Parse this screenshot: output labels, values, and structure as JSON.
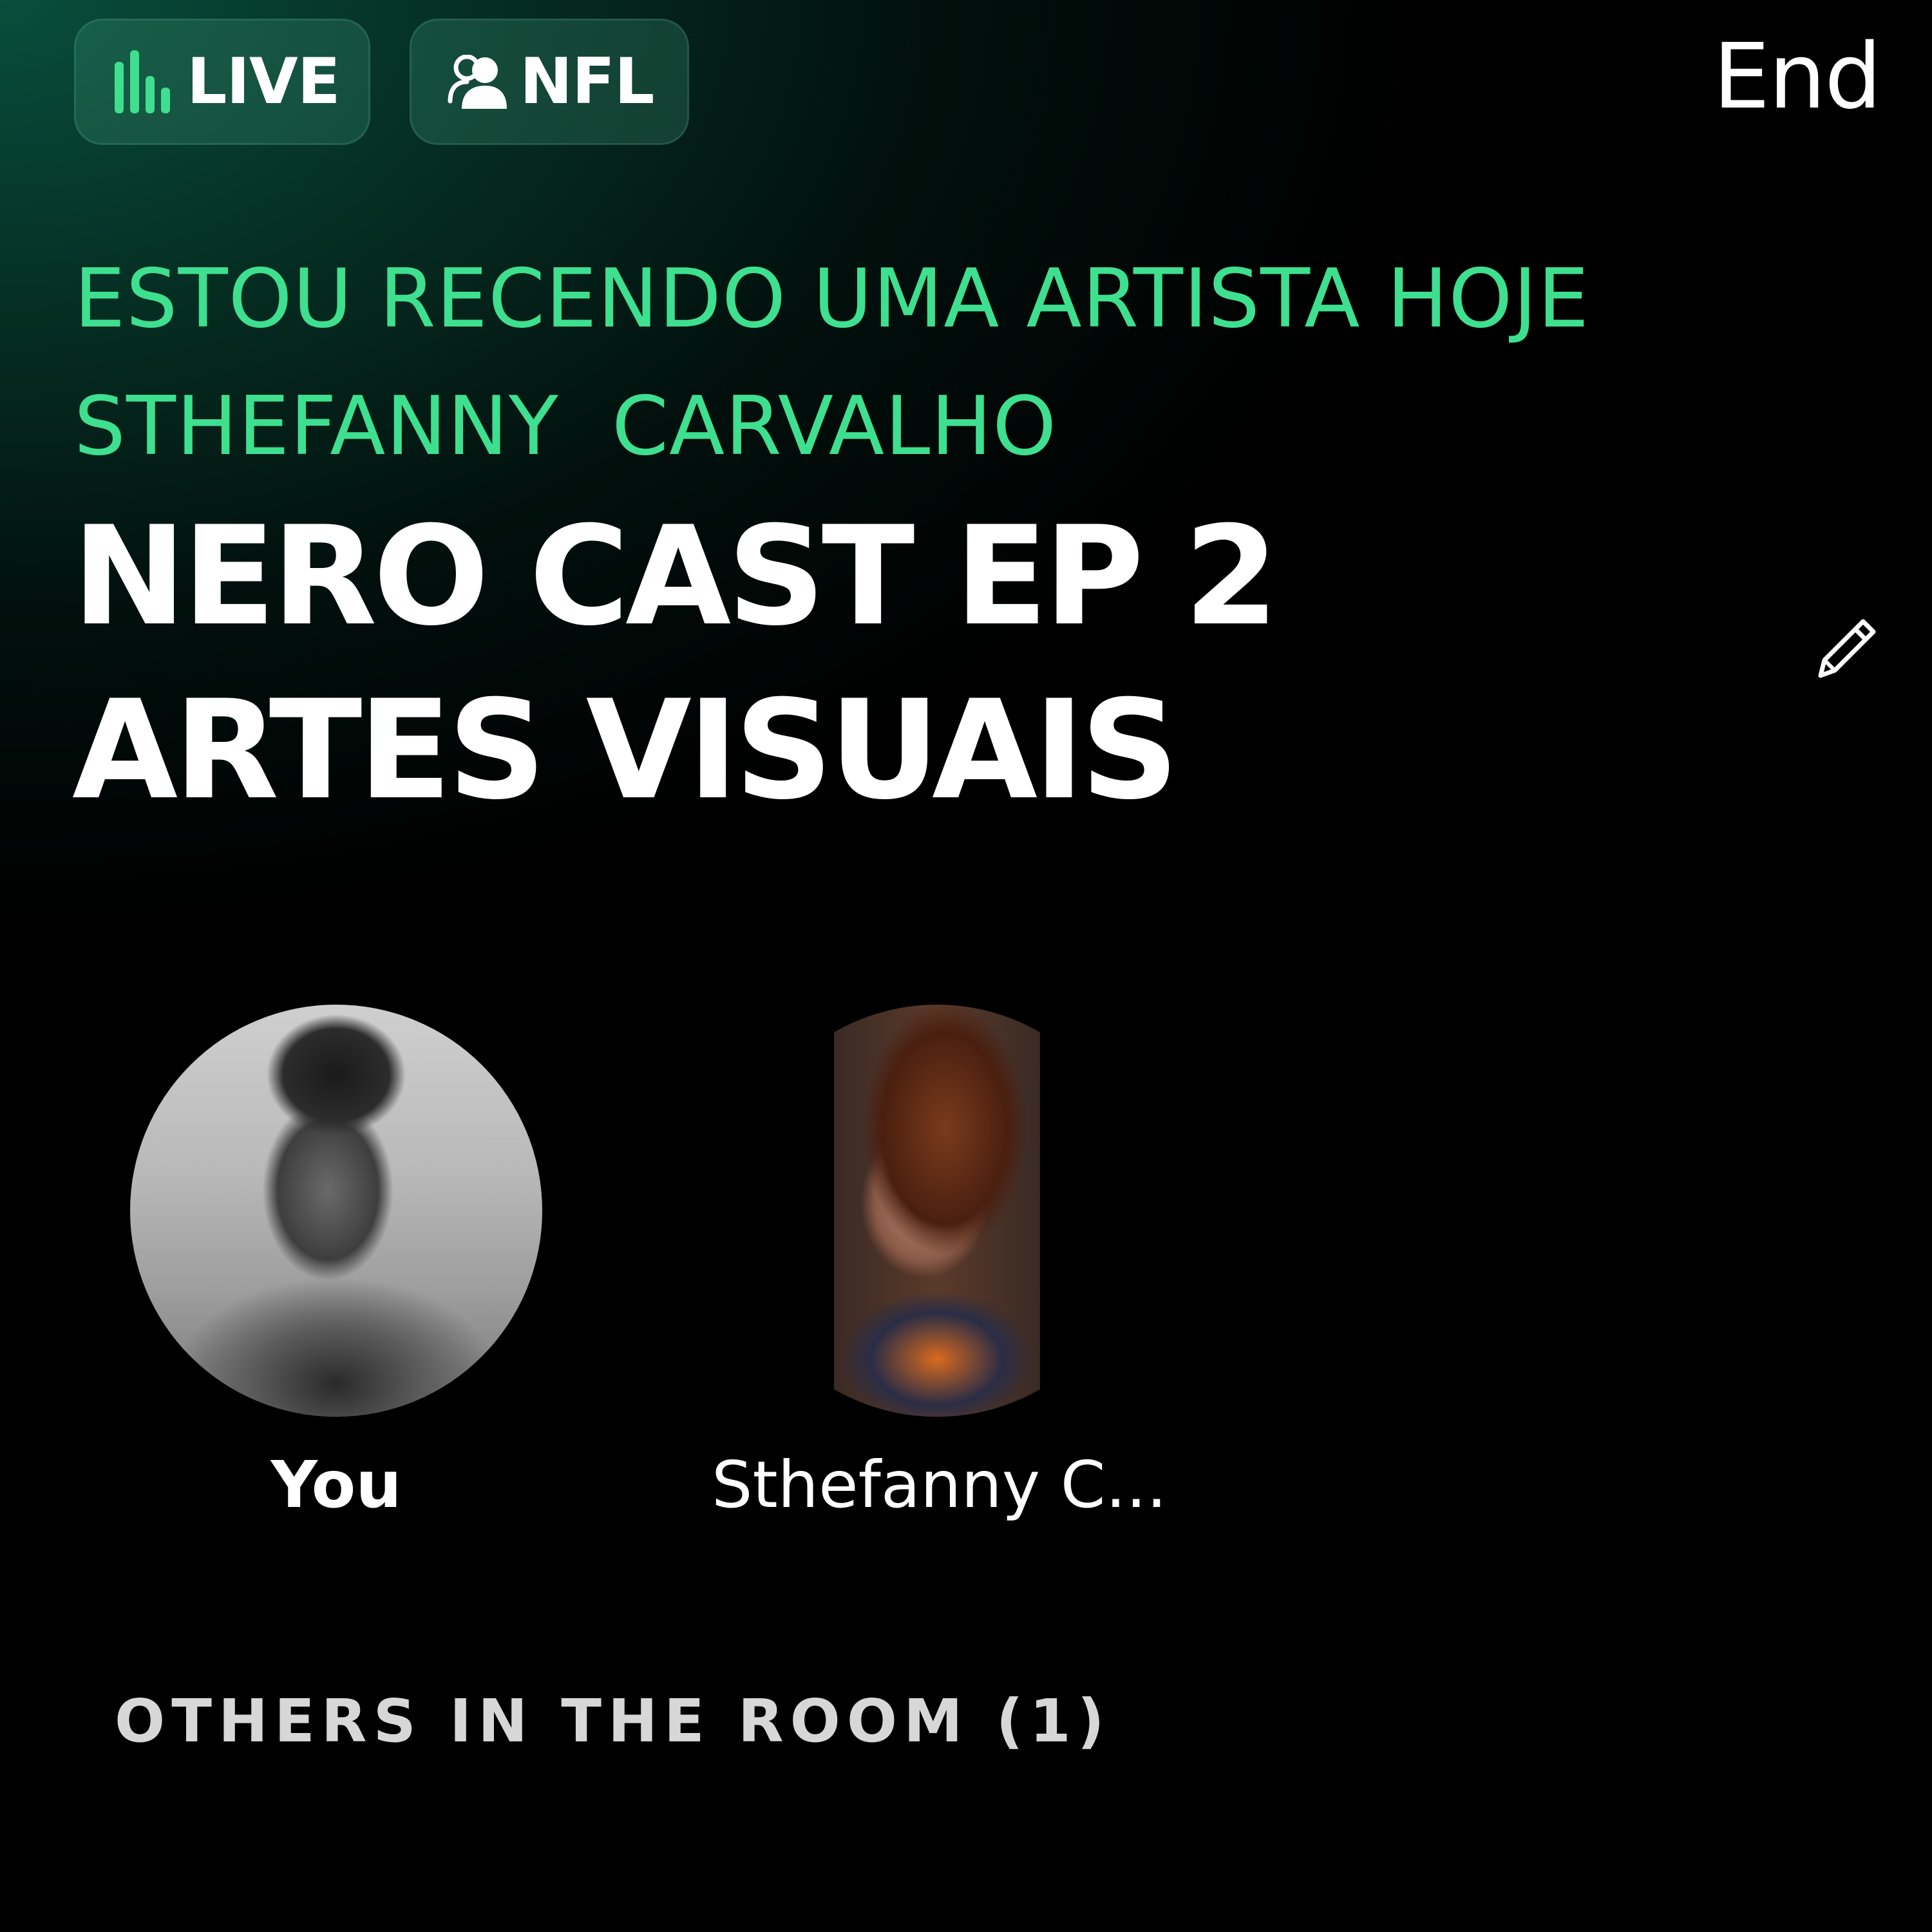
{
  "header": {
    "live_label": "LIVE",
    "topic_label": "NFL",
    "end_label": "End"
  },
  "room": {
    "description": "ESTOU RECENDO UMA ARTISTA HOJE\nSTHEFANNY  CARVALHO",
    "title": "NERO CAST EP 2 ARTES VISUAIS"
  },
  "participants": [
    {
      "name": "You"
    },
    {
      "name": "Sthefanny C..."
    }
  ],
  "others": {
    "heading": "OTHERS IN THE ROOM (1)"
  },
  "colors": {
    "accent": "#3ee08f",
    "background": "#000000",
    "chip_background": "#1f4a3d",
    "text": "#ffffff"
  },
  "icons": {
    "live": "audio-bars-icon",
    "topic": "people-icon",
    "edit": "pencil-icon"
  }
}
